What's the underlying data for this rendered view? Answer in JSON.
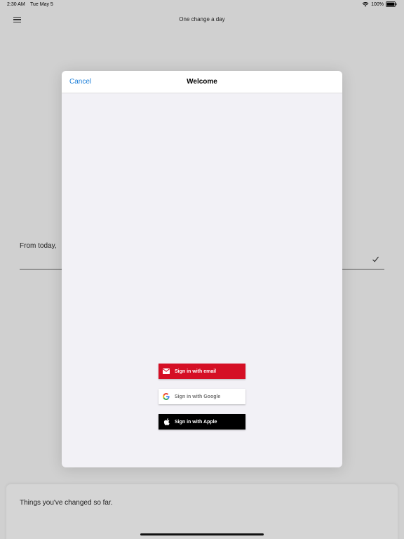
{
  "status_bar": {
    "time": "2:30 AM",
    "date": "Tue May 5",
    "battery": "100%"
  },
  "header": {
    "title": "One change a day"
  },
  "background": {
    "prompt": "From today,",
    "history_heading": "Things you've changed so far."
  },
  "modal": {
    "cancel_label": "Cancel",
    "title": "Welcome",
    "buttons": {
      "email": "Sign in with email",
      "google": "Sign in with Google",
      "apple": "Sign in with Apple"
    }
  },
  "colors": {
    "accent": "#1b7ed8",
    "email_button": "#d50f25",
    "apple_button": "#000000",
    "google_button": "#ffffff"
  }
}
